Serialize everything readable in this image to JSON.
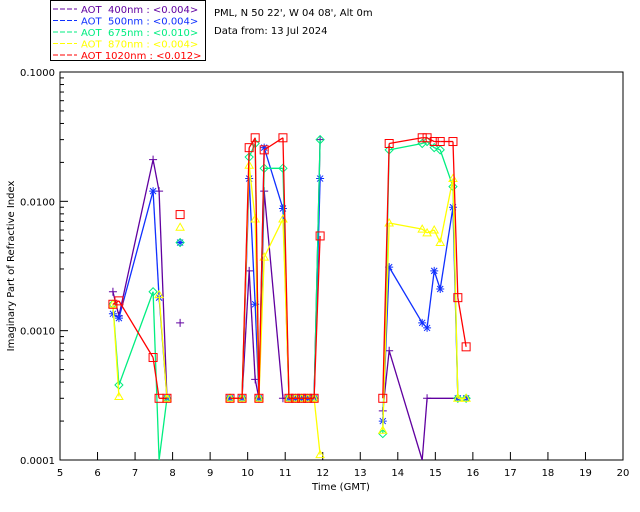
{
  "chart_data": {
    "type": "line",
    "header": {
      "site": "PML, N 50 22', W 04 08', Alt 0m",
      "date": "Data from: 13 Jul 2024"
    },
    "xlabel": "Time (GMT)",
    "ylabel": "Imaginary Part of Refractive Index",
    "xlim": [
      5,
      20
    ],
    "ylim": [
      0.0001,
      0.1
    ],
    "yscale": "log",
    "grid": false,
    "legend_placement": "top-left",
    "xticks": [
      "5",
      "6",
      "7",
      "8",
      "9",
      "10",
      "11",
      "12",
      "13",
      "14",
      "15",
      "16",
      "17",
      "18",
      "19",
      "20"
    ],
    "yticks": [
      "0.0001",
      "0.0010",
      "0.0100",
      "0.1000"
    ],
    "x": [
      6.41,
      6.57,
      7.48,
      7.64,
      7.85,
      8.2,
      9.53,
      9.85,
      10.04,
      10.2,
      10.3,
      10.44,
      10.94,
      11.1,
      11.27,
      11.44,
      11.6,
      11.77,
      11.93,
      13.6,
      13.77,
      14.65,
      14.78,
      14.97,
      15.13,
      15.47,
      15.6,
      15.82
    ],
    "series": [
      {
        "name": "AOT  400nm : <0.004>",
        "color": "#6000a0",
        "marker": "plus",
        "values": [
          0.002,
          0.0013,
          0.021,
          0.012,
          0.0003,
          0.00115,
          0.0003,
          0.0003,
          0.0029,
          0.00042,
          0.0003,
          0.012,
          0.0003,
          0.0003,
          0.0003,
          0.0003,
          0.0003,
          0.0003,
          0.03,
          0.00024,
          0.0007,
          8e-05,
          0.0003,
          null,
          null,
          null,
          0.0003,
          0.0003
        ]
      },
      {
        "name": "AOT  500nm : <0.004>",
        "color": "#1030ff",
        "marker": "asterisk",
        "values": [
          0.00135,
          0.00125,
          0.012,
          0.0018,
          0.0003,
          0.0048,
          0.0003,
          0.0003,
          0.015,
          0.0016,
          0.0003,
          0.026,
          0.0088,
          0.0003,
          0.0003,
          0.0003,
          0.0003,
          0.0003,
          0.015,
          0.0002,
          0.0031,
          0.00115,
          0.00105,
          0.0029,
          0.0021,
          0.009,
          0.0003,
          0.0003
        ]
      },
      {
        "name": "AOT  675nm : <0.010>",
        "color": "#00ee80",
        "marker": "diamond",
        "values": [
          0.0016,
          0.00038,
          0.002,
          8e-05,
          0.0003,
          0.0048,
          0.0003,
          0.0003,
          0.022,
          0.028,
          0.0003,
          0.018,
          0.018,
          0.0003,
          0.0003,
          0.0003,
          0.0003,
          0.0003,
          0.03,
          0.00016,
          0.025,
          0.028,
          0.029,
          0.026,
          0.025,
          0.013,
          0.0003,
          0.0003
        ]
      },
      {
        "name": "AOT  870nm : <0.004>",
        "color": "#ffff00",
        "marker": "triangle",
        "values": [
          0.0016,
          0.00031,
          null,
          0.0019,
          0.0003,
          0.0063,
          0.0003,
          0.0003,
          0.019,
          0.0073,
          0.0003,
          0.0037,
          0.0073,
          0.0003,
          0.0003,
          0.0003,
          0.0003,
          0.0003,
          0.00011,
          0.00017,
          0.0068,
          0.0061,
          0.0057,
          0.006,
          0.0048,
          0.015,
          0.0003,
          0.0003
        ]
      },
      {
        "name": "AOT 1020nm : <0.012>",
        "color": "#ff0000",
        "marker": "square",
        "values": [
          0.0016,
          0.0017,
          0.00062,
          0.0003,
          0.0003,
          0.0079,
          0.0003,
          0.0003,
          0.026,
          0.031,
          0.0003,
          0.025,
          0.031,
          0.0003,
          0.0003,
          0.0003,
          0.0003,
          0.0003,
          0.0054,
          0.0003,
          0.028,
          0.031,
          0.031,
          0.029,
          0.029,
          0.029,
          0.0018,
          0.00075
        ]
      }
    ]
  }
}
